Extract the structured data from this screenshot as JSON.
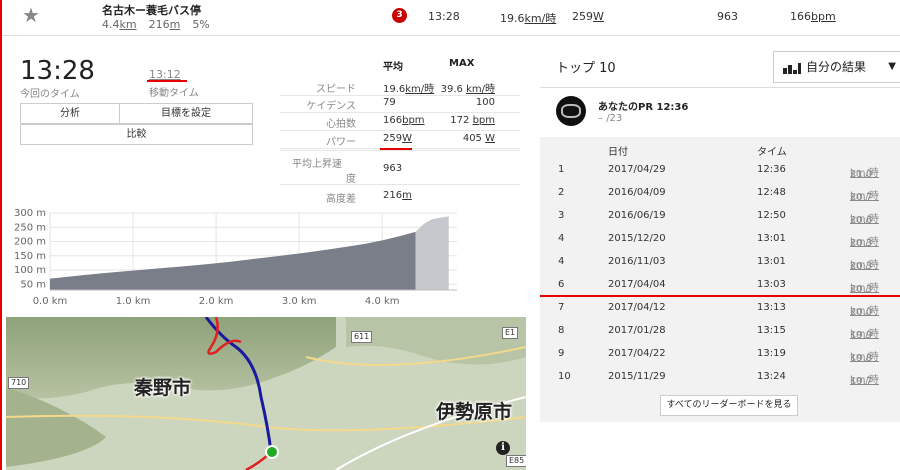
{
  "segment_row": {
    "name": "名古木ー蓑毛バス停",
    "distance": "4.4",
    "distance_unit": "km",
    "elev_gain": "216",
    "elev_unit": "m",
    "grade": "5%",
    "rank_badge": "3",
    "time": "13:28",
    "speed": "19.6",
    "speed_unit": "km/時",
    "power": "259",
    "power_unit": "W",
    "vam": "963",
    "heartrate": "166",
    "hr_unit": "bpm"
  },
  "summary": {
    "elapsed_time": "13:28",
    "elapsed_label": "今回のタイム",
    "moving_time": "13:12",
    "moving_label": "移動タイム",
    "analyze_button": "分析",
    "goal_button": "目標を設定",
    "compare_button": "比較"
  },
  "stats": {
    "col_avg": "平均",
    "col_max": "MAX",
    "rows": [
      {
        "label": "スピード",
        "avg": "19.6",
        "avg_unit": "km/時",
        "max": "39.6",
        "max_unit": "km/時"
      },
      {
        "label": "ケイデンス",
        "avg": "79",
        "avg_unit": "",
        "max": "100",
        "max_unit": ""
      },
      {
        "label": "心拍数",
        "avg": "166",
        "avg_unit": "bpm",
        "max": "172",
        "max_unit": "bpm"
      },
      {
        "label": "パワー",
        "avg": "259",
        "avg_unit": "W",
        "max": "405",
        "max_unit": "W"
      }
    ],
    "vam_label_1": "平均上昇速",
    "vam_label_2": "度",
    "vam_value": "963",
    "elev_label": "高度差",
    "elev_value": "216",
    "elev_unit": "m"
  },
  "chart_data": {
    "type": "area",
    "y_ticks": [
      "300 m",
      "250 m",
      "200 m",
      "150 m",
      "100 m",
      "50 m"
    ],
    "y_tick_values": [
      300,
      250,
      200,
      150,
      100,
      50
    ],
    "x_ticks": [
      "0.0 km",
      "1.0 km",
      "2.0 km",
      "3.0 km",
      "4.0 km"
    ],
    "x_tick_values": [
      0,
      1,
      2,
      3,
      4
    ],
    "xlim": [
      0,
      4.9
    ],
    "ylim": [
      30,
      300
    ],
    "segment_end_km": 4.4,
    "x": [
      0,
      0.2,
      0.4,
      0.6,
      0.8,
      1.0,
      1.2,
      1.4,
      1.6,
      1.8,
      2.0,
      2.2,
      2.4,
      2.6,
      2.8,
      3.0,
      3.2,
      3.4,
      3.6,
      3.8,
      4.0,
      4.2,
      4.4,
      4.5,
      4.6,
      4.7,
      4.8
    ],
    "y": [
      70,
      76,
      82,
      88,
      93,
      98,
      103,
      108,
      113,
      118,
      124,
      130,
      137,
      144,
      151,
      158,
      166,
      174,
      183,
      192,
      204,
      218,
      234,
      262,
      278,
      284,
      288
    ],
    "colors": {
      "segment": "#7a7e88",
      "after": "#c5c8cc"
    }
  },
  "map": {
    "city_left": "秦野市",
    "city_right": "伊勢原市",
    "road_611": "611",
    "road_e1": "E1",
    "road_710": "710",
    "road_e85": "E85",
    "info_icon": "i"
  },
  "top10": {
    "title": "トップ 10",
    "filter_label": "自分の結果",
    "pr_label": "あなたのPR 12:36",
    "pr_dash": "–",
    "pr_rank": "/23",
    "col_date": "日付",
    "col_time": "タイム",
    "rows": [
      {
        "rank": "1",
        "date": "2017/04/29",
        "time": "12:36",
        "speed": "21.0",
        "unit": "km/時"
      },
      {
        "rank": "2",
        "date": "2016/04/09",
        "time": "12:48",
        "speed": "20.7",
        "unit": "km/時"
      },
      {
        "rank": "3",
        "date": "2016/06/19",
        "time": "12:50",
        "speed": "20.6",
        "unit": "km/時"
      },
      {
        "rank": "4",
        "date": "2015/12/20",
        "time": "13:01",
        "speed": "20.3",
        "unit": "km/時"
      },
      {
        "rank": "4",
        "date": "2016/11/03",
        "time": "13:01",
        "speed": "20.3",
        "unit": "km/時"
      },
      {
        "rank": "6",
        "date": "2017/04/04",
        "time": "13:03",
        "speed": "20.3",
        "unit": "km/時"
      },
      {
        "rank": "7",
        "date": "2017/04/12",
        "time": "13:13",
        "speed": "20.0",
        "unit": "km/時"
      },
      {
        "rank": "8",
        "date": "2017/01/28",
        "time": "13:15",
        "speed": "19.9",
        "unit": "km/時"
      },
      {
        "rank": "9",
        "date": "2017/04/22",
        "time": "13:19",
        "speed": "19.8",
        "unit": "km/時"
      },
      {
        "rank": "10",
        "date": "2015/11/29",
        "time": "13:24",
        "speed": "19.7",
        "unit": "km/時"
      }
    ],
    "view_all_button": "すべてのリーダーボードを見る"
  },
  "colors": {
    "accent_red": "#e60000",
    "route_blue": "#1a1aa0",
    "start_green": "#22aa22"
  }
}
